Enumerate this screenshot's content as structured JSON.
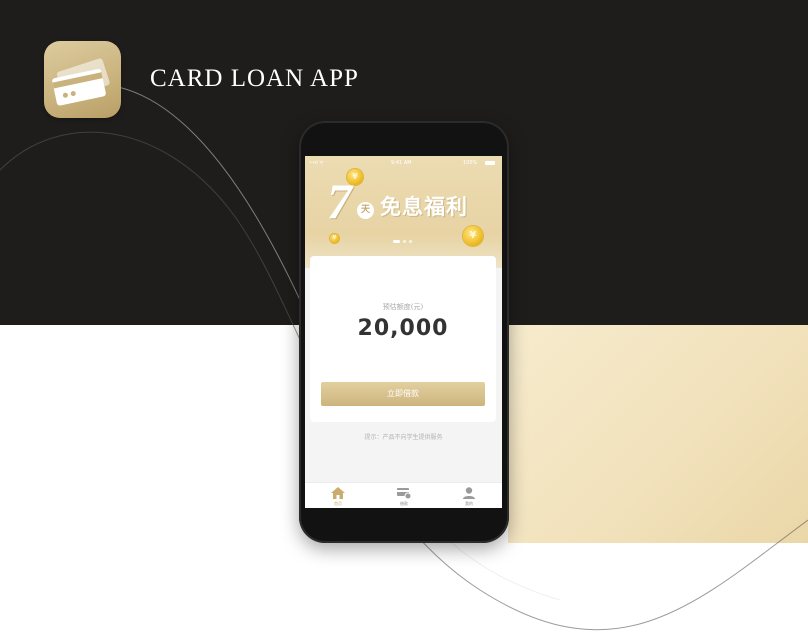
{
  "header": {
    "app_title": "CARD LOAN APP",
    "icon": "credit-cards-icon"
  },
  "phone": {
    "status_bar": {
      "signal": "••ıl ᯤ",
      "time": "9:41 AM",
      "battery": "100%"
    },
    "banner": {
      "number": "7",
      "day": "天",
      "text": "免息福利",
      "coin_glyph": "¥"
    },
    "credit": {
      "label": "预估额度(元)",
      "amount": "20,000"
    },
    "borrow_button": "立即借款",
    "tip": "提示：产品不向学生提供服务",
    "tabs": [
      {
        "label": "首页",
        "icon": "home-icon",
        "active": true
      },
      {
        "label": "借款",
        "icon": "loan-card-icon",
        "active": false
      },
      {
        "label": "我的",
        "icon": "user-icon",
        "active": false
      }
    ]
  },
  "colors": {
    "dark_background": "#1f1d1b",
    "gold_accent": "#cdb47d",
    "light_gold": "#f2e2bc"
  }
}
